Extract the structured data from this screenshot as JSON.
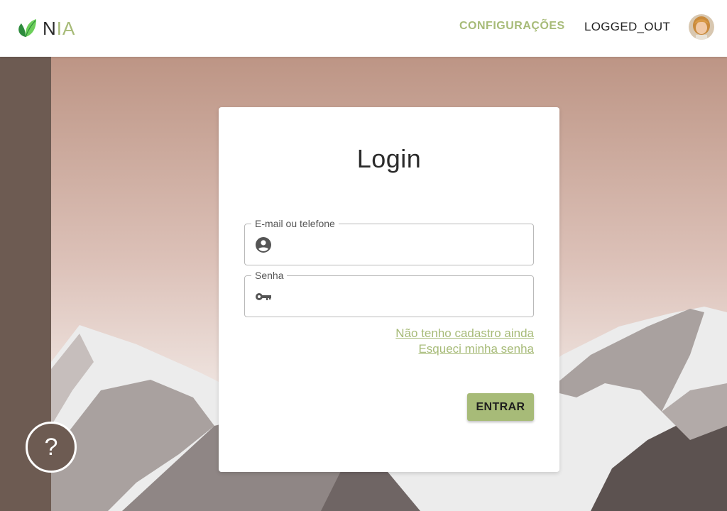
{
  "header": {
    "logo": {
      "text_main": "N",
      "text_accent": "IA"
    },
    "nav": {
      "settings_label": "CONFIGURAÇÕES",
      "status_label": "LOGGED_OUT"
    },
    "avatar_icon": "user-avatar"
  },
  "help_button": {
    "label": "?",
    "icon": "question-mark-icon"
  },
  "login_card": {
    "title": "Login",
    "email_field": {
      "label": "E-mail ou telefone",
      "value": "",
      "placeholder": "",
      "icon": "account-circle-icon"
    },
    "password_field": {
      "label": "Senha",
      "value": "",
      "placeholder": "",
      "icon": "key-icon"
    },
    "links": {
      "register": "Não tenho cadastro ainda",
      "forgot_password": "Esqueci minha senha"
    },
    "submit_label": "ENTRAR"
  },
  "colors": {
    "accent": "#a7bb78",
    "side_strip": "#6d5b52",
    "sky_top": "#bd9585",
    "sky_bottom": "#f0e6e2"
  }
}
